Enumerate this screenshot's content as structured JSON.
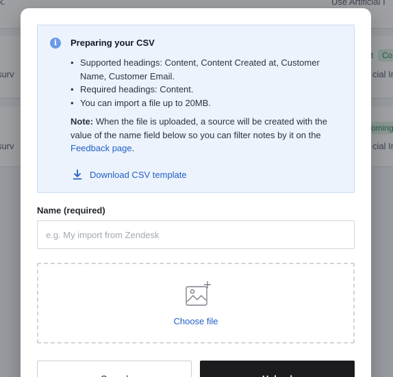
{
  "background": {
    "top_left_text": "k.",
    "top_right_text": "Use Artificial I",
    "row1_left": "surv",
    "row1_tag_a": "t",
    "row1_tag_b": "Co",
    "row1_right": "cial In",
    "row2_left": "surv",
    "row2_tag": "oming",
    "row2_right": "cial In"
  },
  "modal": {
    "info": {
      "icon": "info-icon",
      "title": "Preparing your CSV",
      "bullets": [
        "Supported headings: Content, Content Created at, Customer Name, Customer Email.",
        "Required headings: Content.",
        "You can import a file up to 20MB."
      ],
      "note_label": "Note:",
      "note_text": " When the file is uploaded, a source will be created with the value of the name field below so you can filter notes by it on the ",
      "note_link": "Feedback page",
      "note_end": ".",
      "download_label": "Download CSV template"
    },
    "name_field": {
      "label": "Name (required)",
      "value": "",
      "placeholder": "e.g. My import from Zendesk"
    },
    "dropzone": {
      "icon": "image-add-icon",
      "label": "Choose file"
    },
    "buttons": {
      "cancel": "Cancel",
      "upload": "Upload"
    }
  },
  "colors": {
    "info_bg": "#edf3fd",
    "link": "#1f5fc4",
    "primary_button": "#1c1c1e"
  }
}
